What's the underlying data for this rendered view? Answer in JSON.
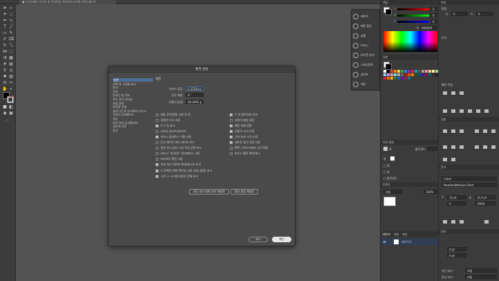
{
  "window": {
    "title_tab": "● 오디오배너 오디오 및 문서파일 이미지오디오배 브로드캐스트"
  },
  "toolbar": {
    "fill_color": "#000000",
    "stroke_color": "#ffffff",
    "accent": "#e03a3a"
  },
  "dock": {
    "items": [
      {
        "label": "레이어"
      },
      {
        "label": "패턴 옵션"
      },
      {
        "label": "심볼"
      },
      {
        "label": "브러시"
      },
      {
        "label": "아이콘 추적"
      },
      {
        "label": "그라디언트"
      },
      {
        "label": "글리프"
      },
      {
        "label": "색상"
      }
    ]
  },
  "color_panel": {
    "title": "색상",
    "r_value": "0",
    "g_value": "0",
    "b_value": "0",
    "hex": "000000",
    "guide_label": "색상 가이드"
  },
  "swatches_panel": {
    "title": "견본"
  },
  "layers_panel": {
    "tabs": [
      "레이어",
      "대지",
      "에셋"
    ],
    "layer_name": "레이어 1"
  },
  "mid_panels": {
    "appearance_title": "모양 설정",
    "stroke_label": "획",
    "fill_label": "칠",
    "opacity_label": "불투명도",
    "align_title": "투명도",
    "mode": "보통",
    "opacity_value": "100%"
  },
  "properties": {
    "tab_props": "속성",
    "transform": "변형",
    "x_val": "0",
    "y_val": "0",
    "quick_actions": "빠른 작업",
    "document": "문서",
    "align": "정렬",
    "character": "문자",
    "font_family": "Cabin",
    "font_style": "NewYorkMedium Bold",
    "size": "12 pt",
    "leading": "14.4 pt",
    "tracking": "0",
    "scale": "100%",
    "paragraph": "단락",
    "indent_a": "0 pt",
    "indent_b": "0 pt",
    "hyphen_label": "자간 처리",
    "hyphen_val": "보통",
    "more_label": "문자 처리",
    "more_val": "보통"
  },
  "dialog": {
    "title": "환경 설정",
    "nav": [
      "일반",
      "선택 및 고정점 표시",
      "문자",
      "단위",
      "안내선 및 격자",
      "특수 문자 안내선",
      "분할 영역",
      "하이픈 연결",
      "플러그인 및 스크래치 디스크",
      "사용자 인터페이스",
      "성능",
      "파일 처리 및 클립보드",
      "검은색 모양",
      "장치"
    ],
    "section_title": "일반",
    "keyboard_increment_label": "키보드 증감:",
    "keyboard_increment_value": "0.3528 px",
    "constrain_angle_label": "각도 제한:",
    "constrain_angle_value": "0°",
    "corner_radius_label": "모퉁이 반경:",
    "corner_radius_value": "28.3465 p",
    "left_checks": [
      {
        "label": "제동 추적/생략 사용 안 함",
        "checked": false
      },
      {
        "label": "정밀한 커서 사용",
        "checked": false
      },
      {
        "label": "도구 팁 표시",
        "checked": true
      },
      {
        "label": "오류지 글리프(글리프)",
        "checked": false
      },
      {
        "label": "레거시 플레이스 이름 사용",
        "checked": true
      },
      {
        "label": "문서 레이어 제거 세이프 모드",
        "checked": false
      },
      {
        "label": "열린 문서 없이 시작 작업 영역 표시",
        "checked": false
      },
      {
        "label": "레거시 \"새 파일\" 인터페이스 사용",
        "checked": false
      },
      {
        "label": "미리보기 확장 사용",
        "checked": false
      },
      {
        "label": "인쇄 미리 100% 확대/축소로 보기",
        "checked": true
      },
      {
        "label": "더 정확한 화면 렌더링 사용 (세부 품질) 표시",
        "checked": true
      },
      {
        "label": "시작 시 시스템 호환성 문제 표시",
        "checked": true
      }
    ],
    "right_checks": [
      {
        "label": "두 번 클릭하여 격리",
        "checked": true
      },
      {
        "label": "레이어 패널 사용",
        "checked": false
      },
      {
        "label": "패턴 비율 변환",
        "checked": true
      },
      {
        "label": "모퉁이 크기 조정",
        "checked": true
      },
      {
        "label": "선과 효과 크기 조정",
        "checked": true
      },
      {
        "label": "새로운 방식 지정 사용",
        "checked": true
      },
      {
        "label": "PDF 가져오기에서 크기 적용",
        "checked": false
      },
      {
        "label": "마우스 휠로 확대/축소",
        "checked": false
      }
    ],
    "reset_warnings_label": "모든 경고 대화 상자 재설정",
    "reset_prefs_label": "환경 설정 재설정",
    "cancel_label": "취소",
    "ok_label": "확인"
  }
}
